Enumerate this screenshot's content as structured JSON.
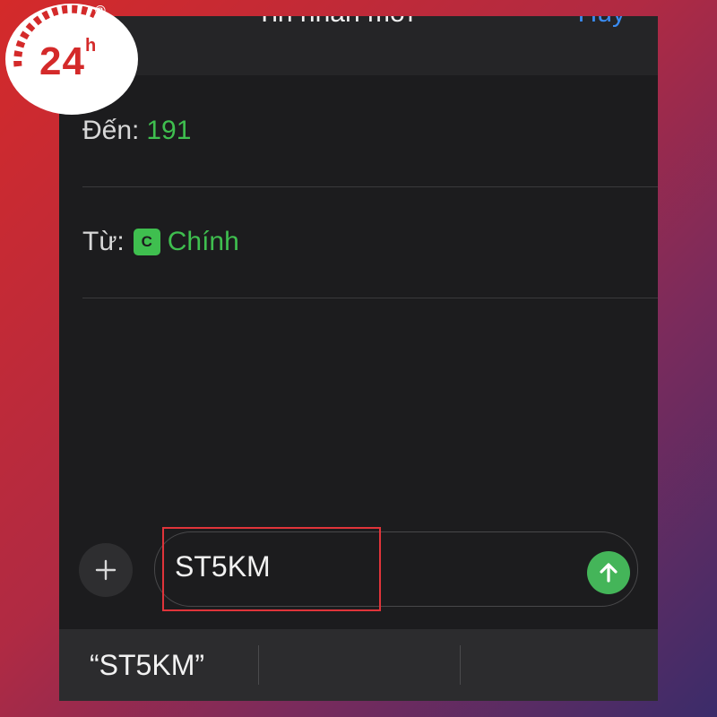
{
  "header": {
    "title": "Tin nhắn mới",
    "cancel_label": "Hủy"
  },
  "recipient": {
    "label": "Đến:",
    "value": "191"
  },
  "sender": {
    "label": "Từ:",
    "sim_badge": "C",
    "value": "Chính"
  },
  "composer": {
    "add_icon": "plus-icon",
    "text": "ST5KM",
    "send_icon": "arrow-up-icon"
  },
  "suggestions": {
    "items": [
      "“ST5KM”",
      "",
      ""
    ]
  },
  "logo": {
    "text": "24",
    "superscript": "h",
    "registered": "®"
  },
  "colors": {
    "accent_green": "#3fbf4f",
    "send_green": "#44b559",
    "link_blue": "#3a8bf0",
    "highlight_red": "#e0343a",
    "background_dark": "#1c1c1e"
  }
}
